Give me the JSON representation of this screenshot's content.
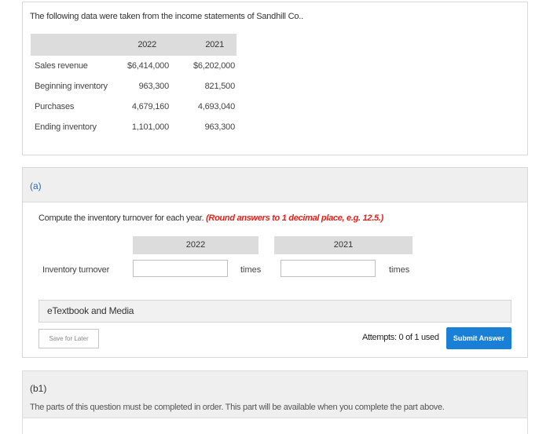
{
  "problem": {
    "intro": "The following data were taken from the income statements of Sandhill Co..",
    "columns": [
      "2022",
      "2021"
    ],
    "rows": [
      {
        "label": "Sales revenue",
        "v2022": "$6,414,000",
        "v2021": "$6,202,000"
      },
      {
        "label": "Beginning inventory",
        "v2022": "963,300",
        "v2021": "821,500"
      },
      {
        "label": "Purchases",
        "v2022": "4,679,160",
        "v2021": "4,693,040"
      },
      {
        "label": "Ending inventory",
        "v2022": "1,101,000",
        "v2021": "963,300"
      }
    ]
  },
  "part_a": {
    "label": "(a)",
    "instruction": "Compute the inventory turnover for each year.",
    "rounding_note": "(Round answers to 1 decimal place, e.g. 12.5.)",
    "col_2022": "2022",
    "col_2021": "2021",
    "row_label": "Inventory turnover",
    "input_2022": "",
    "input_2021": "",
    "unit_2022": "times",
    "unit_2021": "times",
    "etextbook": "eTextbook and Media",
    "save_label": "Save for Later",
    "attempts": "Attempts: 0 of 1 used",
    "submit_label": "Submit Answer"
  },
  "part_b1": {
    "label": "(b1)",
    "message": "The parts of this question must be completed in order. This part will be available when you complete the part above."
  },
  "colors": {
    "link_blue": "#1a6bc9",
    "submit_blue": "#1a7fd6",
    "note_red": "#e0211b"
  }
}
